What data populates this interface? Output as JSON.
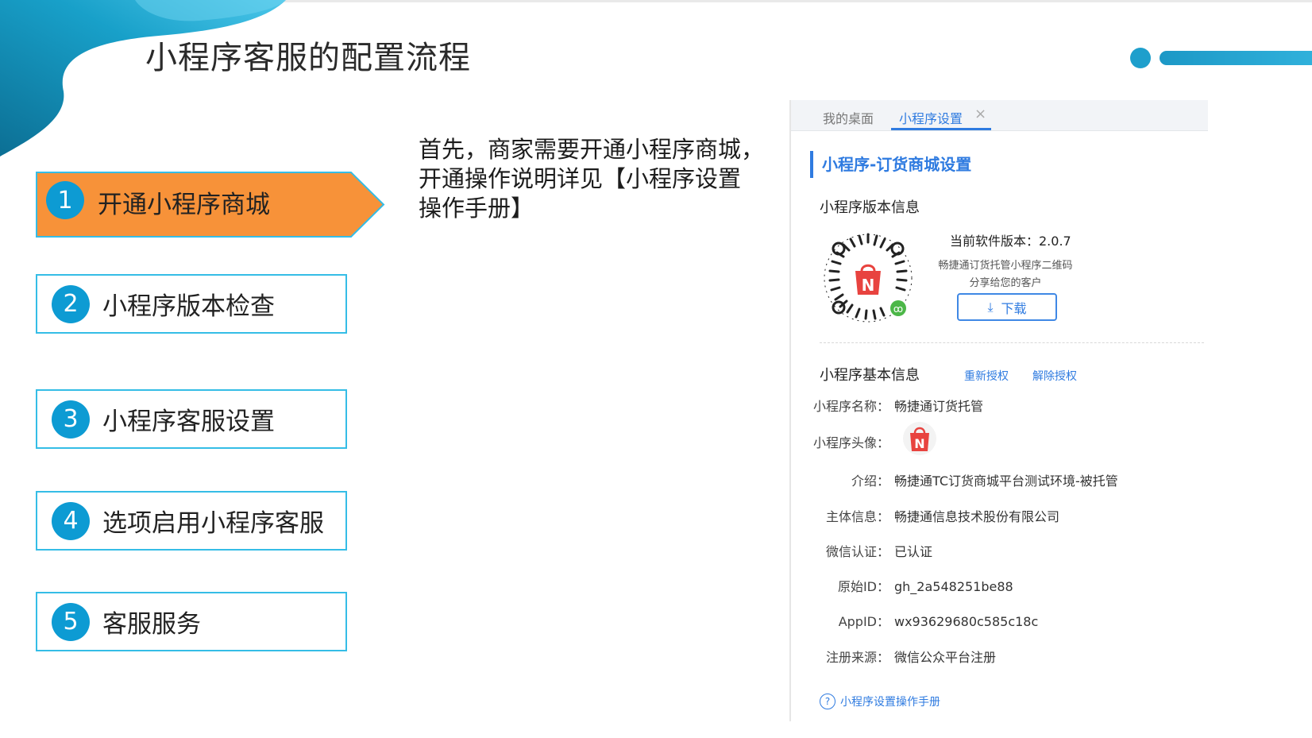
{
  "slide": {
    "title": "小程序客服的配置流程",
    "colors": {
      "accent": "#0d9bd3",
      "active_step": "#f79239",
      "step_border": "#35bde6",
      "link": "#2f7be0"
    }
  },
  "steps": [
    {
      "num": "1",
      "label": "开通小程序商城",
      "active": true
    },
    {
      "num": "2",
      "label": "小程序版本检查",
      "active": false
    },
    {
      "num": "3",
      "label": "小程序客服设置",
      "active": false
    },
    {
      "num": "4",
      "label": "选项启用小程序客服",
      "active": false
    },
    {
      "num": "5",
      "label": "客服服务",
      "active": false
    }
  ],
  "intro": {
    "line1": "首先，商家需要开通小程序商城，",
    "line2": "开通操作说明详见【小程序设置",
    "line3": "操作手册】"
  },
  "panel": {
    "tabs": [
      {
        "label": "我的桌面",
        "active": false
      },
      {
        "label": "小程序设置",
        "active": true
      }
    ],
    "close_icon": "×",
    "section_title": "小程序-订货商城设置",
    "version": {
      "heading": "小程序版本信息",
      "current_version": "当前软件版本：2.0.7",
      "qr_note_1": "畅捷通订货托管小程序二维码",
      "qr_note_2": "分享给您的客户",
      "download_label": "下载",
      "qr_icon": "mini-program-qr-code",
      "logo_letter": "N"
    },
    "basic": {
      "heading": "小程序基本信息",
      "reauthorize": "重新授权",
      "unauthorize": "解除授权",
      "name": {
        "label": "小程序名称：",
        "value": "畅捷通订货托管"
      },
      "avatar": {
        "label": "小程序头像：",
        "letter": "N"
      },
      "intro": {
        "label": "介绍：",
        "value": "畅捷通TC订货商城平台测试环境-被托管"
      },
      "entity": {
        "label": "主体信息：",
        "value": "畅捷通信息技术股份有限公司"
      },
      "wechat_cert": {
        "label": "微信认证：",
        "value": "已认证"
      },
      "original_id": {
        "label": "原始ID：",
        "value": "gh_2a548251be88"
      },
      "appid": {
        "label": "AppID：",
        "value": "wx93629680c585c18c"
      },
      "source": {
        "label": "注册来源：",
        "value": "微信公众平台注册"
      }
    },
    "help_link": "小程序设置操作手册"
  }
}
